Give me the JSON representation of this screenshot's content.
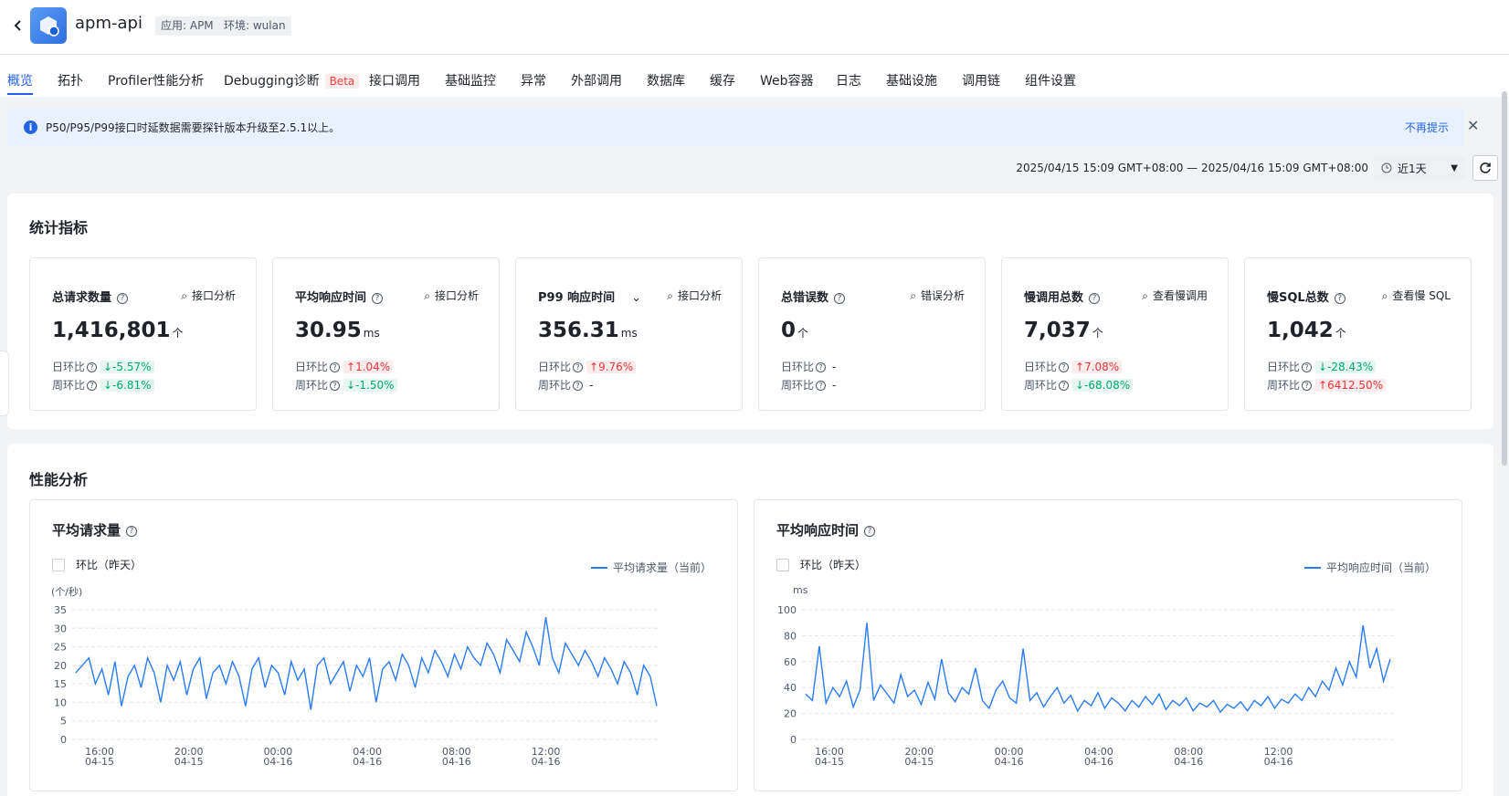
{
  "header": {
    "app_name": "apm-api",
    "tag_app": "应用: APM",
    "tag_env": "环境: wulan"
  },
  "tabs": [
    {
      "label": "概览",
      "active": true
    },
    {
      "label": "拓扑"
    },
    {
      "label": "Profiler性能分析"
    },
    {
      "label": "Debugging诊断",
      "badge": "Beta"
    },
    {
      "label": "接口调用"
    },
    {
      "label": "基础监控"
    },
    {
      "label": "异常"
    },
    {
      "label": "外部调用"
    },
    {
      "label": "数据库"
    },
    {
      "label": "缓存"
    },
    {
      "label": "Web容器"
    },
    {
      "label": "日志"
    },
    {
      "label": "基础设施"
    },
    {
      "label": "调用链"
    },
    {
      "label": "组件设置"
    }
  ],
  "notice": {
    "text": "P50/P95/P99接口时延数据需要探针版本升级至2.5.1以上。",
    "dismiss": "不再提示"
  },
  "timebar": {
    "range": "2025/04/15 15:09 GMT+08:00 — 2025/04/16 15:09 GMT+08:00",
    "preset": "近1天"
  },
  "stats": {
    "title": "统计指标",
    "day_label": "日环比",
    "week_label": "周环比",
    "cards": [
      {
        "title": "总请求数量",
        "link": "接口分析",
        "value": "1,416,801",
        "unit": "个",
        "day": "↓-5.57%",
        "day_dir": "down",
        "week": "↓-6.81%",
        "week_dir": "down"
      },
      {
        "title": "平均响应时间",
        "link": "接口分析",
        "value": "30.95",
        "unit": "ms",
        "day": "↑1.04%",
        "day_dir": "up",
        "week": "↓-1.50%",
        "week_dir": "down"
      },
      {
        "title": "P99 响应时间",
        "link": "接口分析",
        "value": "356.31",
        "unit": "ms",
        "day": "↑9.76%",
        "day_dir": "up",
        "week": "-",
        "week_dir": "none"
      },
      {
        "title": "总错误数",
        "link": "错误分析",
        "value": "0",
        "unit": "个",
        "day": "-",
        "day_dir": "none",
        "week": "-",
        "week_dir": "none"
      },
      {
        "title": "慢调用总数",
        "link": "查看慢调用",
        "value": "7,037",
        "unit": "个",
        "day": "↑7.08%",
        "day_dir": "up",
        "week": "↓-68.08%",
        "week_dir": "down"
      },
      {
        "title": "慢SQL总数",
        "link": "查看慢 SQL",
        "value": "1,042",
        "unit": "个",
        "day": "↓-28.43%",
        "day_dir": "down",
        "week": "↑6412.50%",
        "week_dir": "up"
      }
    ]
  },
  "perf": {
    "title": "性能分析",
    "charts": [
      {
        "title": "平均请求量",
        "compare_label": "环比（昨天）",
        "legend": "平均请求量（当前）",
        "yunit": "(个/秒)",
        "color": "#2a7cf5"
      },
      {
        "title": "平均响应时间",
        "compare_label": "环比（昨天）",
        "legend": "平均响应时间（当前）",
        "yunit": "ms",
        "color": "#2a7cf5"
      }
    ]
  },
  "chart_data": [
    {
      "type": "line",
      "title": "平均请求量",
      "ylabel": "(个/秒)",
      "ylim": [
        0,
        35
      ],
      "yticks": [
        "0",
        "5",
        "10",
        "15",
        "20",
        "25",
        "30",
        "35"
      ],
      "xticks": [
        [
          "16:00",
          "04-15"
        ],
        [
          "20:00",
          "04-15"
        ],
        [
          "00:00",
          "04-16"
        ],
        [
          "04:00",
          "04-16"
        ],
        [
          "08:00",
          "04-16"
        ],
        [
          "12:00",
          "04-16"
        ]
      ],
      "series": [
        {
          "name": "平均请求量（当前）",
          "values": [
            18,
            20,
            22,
            15,
            19,
            12,
            21,
            9,
            17,
            20,
            14,
            22,
            18,
            10,
            20,
            16,
            21,
            12,
            19,
            22,
            11,
            18,
            20,
            15,
            21,
            17,
            9,
            19,
            22,
            14,
            20,
            18,
            12,
            21,
            16,
            19,
            8,
            20,
            22,
            15,
            18,
            21,
            13,
            20,
            17,
            22,
            10,
            19,
            21,
            16,
            23,
            20,
            14,
            22,
            18,
            24,
            21,
            17,
            23,
            19,
            25,
            22,
            20,
            26,
            23,
            18,
            27,
            24,
            21,
            29,
            25,
            20,
            33,
            22,
            18,
            26,
            23,
            20,
            24,
            21,
            17,
            22,
            19,
            15,
            21,
            18,
            12,
            20,
            17,
            9
          ]
        }
      ],
      "grid": true
    },
    {
      "type": "line",
      "title": "平均响应时间",
      "ylabel": "ms",
      "ylim": [
        0,
        100
      ],
      "yticks": [
        "0",
        "20",
        "40",
        "60",
        "80",
        "100"
      ],
      "xticks": [
        [
          "16:00",
          "04-15"
        ],
        [
          "20:00",
          "04-15"
        ],
        [
          "00:00",
          "04-16"
        ],
        [
          "04:00",
          "04-16"
        ],
        [
          "08:00",
          "04-16"
        ],
        [
          "12:00",
          "04-16"
        ]
      ],
      "series": [
        {
          "name": "平均响应时间（当前）",
          "values": [
            35,
            30,
            72,
            28,
            40,
            33,
            45,
            25,
            38,
            90,
            30,
            42,
            35,
            28,
            50,
            33,
            38,
            27,
            44,
            31,
            62,
            36,
            29,
            40,
            35,
            55,
            30,
            24,
            38,
            45,
            32,
            28,
            70,
            30,
            36,
            25,
            33,
            40,
            28,
            34,
            22,
            30,
            26,
            36,
            24,
            32,
            28,
            22,
            30,
            25,
            33,
            27,
            35,
            23,
            30,
            26,
            32,
            22,
            28,
            25,
            30,
            21,
            27,
            24,
            29,
            22,
            30,
            26,
            33,
            24,
            31,
            28,
            35,
            30,
            40,
            33,
            45,
            38,
            55,
            42,
            60,
            48,
            88,
            55,
            70,
            45,
            62
          ]
        }
      ],
      "grid": true
    }
  ]
}
